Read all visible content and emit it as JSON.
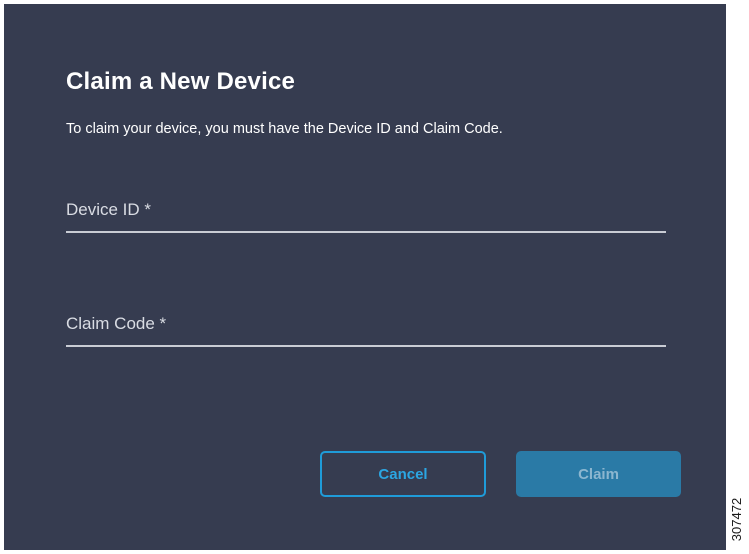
{
  "dialog": {
    "title": "Claim a New Device",
    "subtitle": "To claim your device, you must have the Device ID and Claim Code.",
    "fields": {
      "device_id": {
        "placeholder": "Device ID *",
        "value": ""
      },
      "claim_code": {
        "placeholder": "Claim Code *",
        "value": ""
      }
    },
    "buttons": {
      "cancel_label": "Cancel",
      "claim_label": "Claim"
    }
  },
  "figure_id": "307472",
  "colors": {
    "dialog_background": "#363c50",
    "accent": "#1f9bd8",
    "claim_button_disabled": "#2a7aa6"
  }
}
